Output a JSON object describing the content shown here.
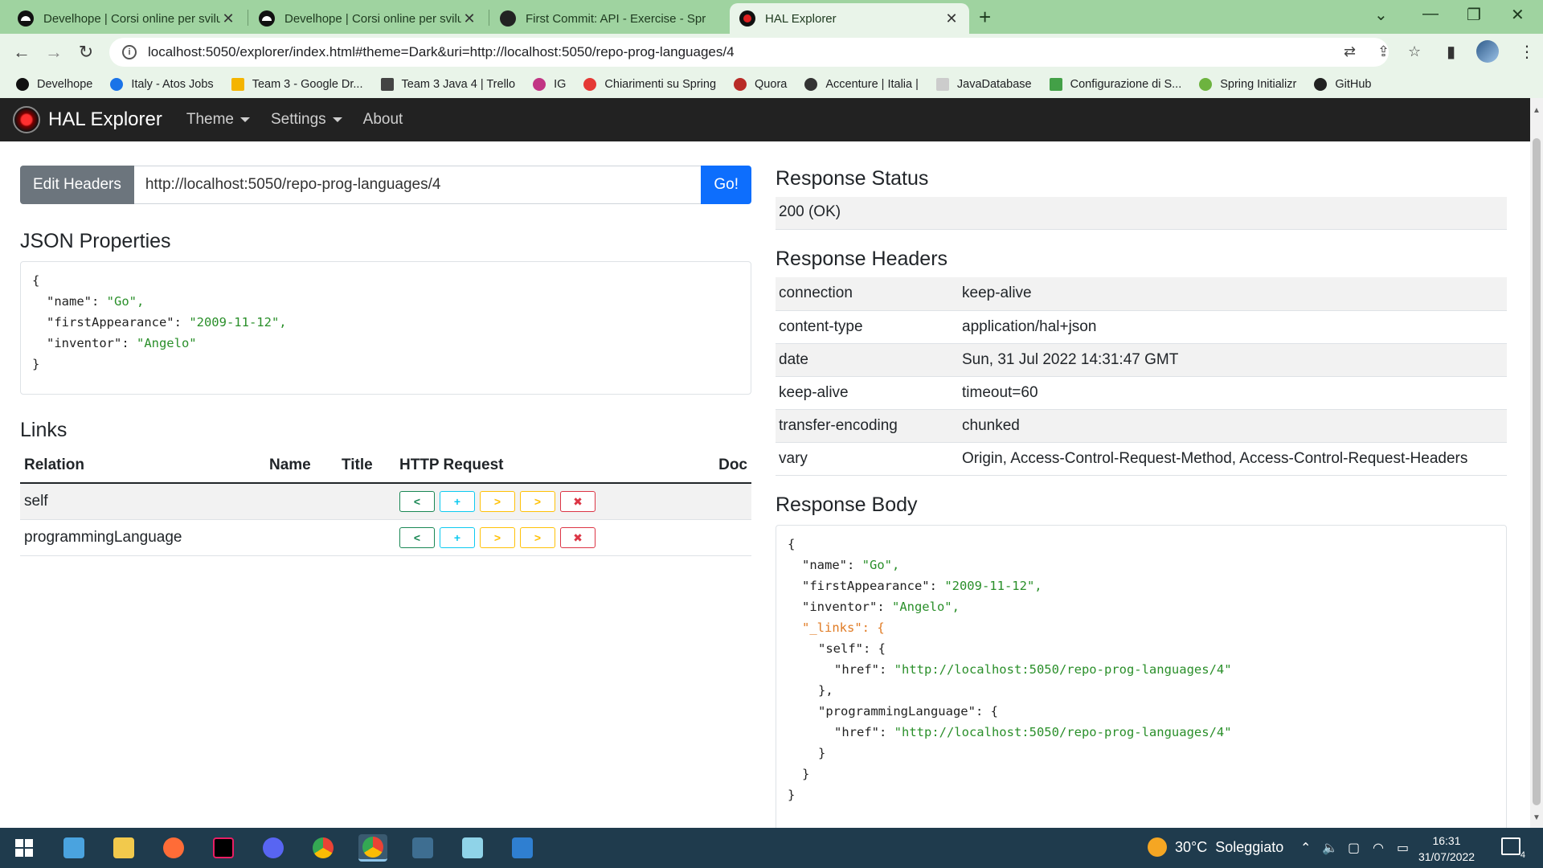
{
  "browser": {
    "tabs": [
      {
        "title": "Develhope | Corsi online per svilu",
        "active": false
      },
      {
        "title": "Develhope | Corsi online per svilu",
        "active": false
      },
      {
        "title": "First Commit: API - Exercise - Spr",
        "active": false
      },
      {
        "title": "HAL Explorer",
        "active": true
      }
    ],
    "address": "localhost:5050/explorer/index.html#theme=Dark&uri=http://localhost:5050/repo-prog-languages/4",
    "bookmarks": [
      {
        "label": "Develhope",
        "color": "#111111"
      },
      {
        "label": "Italy - Atos Jobs",
        "color": "#1a73e8"
      },
      {
        "label": "Team 3 - Google Dr...",
        "color": "#f4b400"
      },
      {
        "label": "Team 3 Java 4 | Trello",
        "color": "#444444"
      },
      {
        "label": "IG",
        "color": "#c13584"
      },
      {
        "label": "Chiarimenti su Spring",
        "color": "#e53935"
      },
      {
        "label": "Quora",
        "color": "#b92b27"
      },
      {
        "label": "Accenture | Italia |",
        "color": "#333333"
      },
      {
        "label": "JavaDatabase",
        "color": "#cccccc"
      },
      {
        "label": "Configurazione di S...",
        "color": "#43a047"
      },
      {
        "label": "Spring Initializr",
        "color": "#6db33f"
      },
      {
        "label": "GitHub",
        "color": "#222222"
      }
    ]
  },
  "app": {
    "brand": "HAL Explorer",
    "nav": {
      "theme": "Theme",
      "settings": "Settings",
      "about": "About"
    }
  },
  "request": {
    "edit_headers": "Edit Headers",
    "url": "http://localhost:5050/repo-prog-languages/4",
    "go": "Go!"
  },
  "json_properties": {
    "title": "JSON Properties",
    "lines": [
      "{",
      "\"name\": ",
      "\"Go\",",
      "\"firstAppearance\": ",
      "\"2009-11-12\",",
      "\"inventor\": ",
      "\"Angelo\"",
      "}"
    ]
  },
  "links": {
    "title": "Links",
    "headers": {
      "relation": "Relation",
      "name": "Name",
      "title": "Title",
      "http": "HTTP Request",
      "doc": "Doc"
    },
    "rows": [
      {
        "relation": "self"
      },
      {
        "relation": "programmingLanguage"
      }
    ]
  },
  "response_status": {
    "title": "Response Status",
    "value": "200 (OK)"
  },
  "response_headers": {
    "title": "Response Headers",
    "rows": [
      {
        "key": "connection",
        "value": "keep-alive"
      },
      {
        "key": "content-type",
        "value": "application/hal+json"
      },
      {
        "key": "date",
        "value": "Sun, 31 Jul 2022 14:31:47 GMT"
      },
      {
        "key": "keep-alive",
        "value": "timeout=60"
      },
      {
        "key": "transfer-encoding",
        "value": "chunked"
      },
      {
        "key": "vary",
        "value": "Origin, Access-Control-Request-Method, Access-Control-Request-Headers"
      }
    ]
  },
  "response_body": {
    "title": "Response Body",
    "name_key": "\"name\": ",
    "name_val": "\"Go\",",
    "fa_key": "\"firstAppearance\": ",
    "fa_val": "\"2009-11-12\",",
    "inv_key": "\"inventor\": ",
    "inv_val": "\"Angelo\",",
    "links_key": "\"_links\": {",
    "self_key": "\"self\": {",
    "href_key": "\"href\": ",
    "self_href": "\"http://localhost:5050/repo-prog-languages/4\"",
    "pl_key": "\"programmingLanguage\": {",
    "pl_href": "\"http://localhost:5050/repo-prog-languages/4\""
  },
  "taskbar": {
    "weather_temp": "30°C",
    "weather_text": "Soleggiato",
    "time": "16:31",
    "date": "31/07/2022",
    "notifications": "4"
  }
}
